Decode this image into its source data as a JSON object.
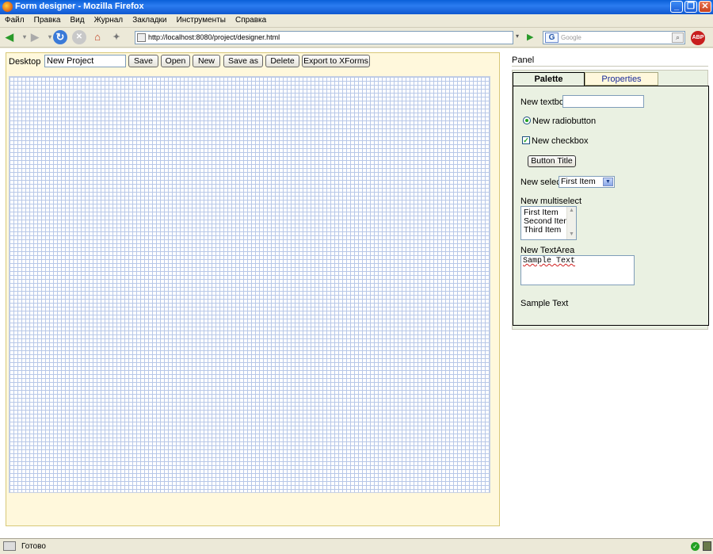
{
  "window": {
    "title": "Form designer - Mozilla Firefox",
    "minimize": "_",
    "maximize": "❐",
    "close": "✕"
  },
  "menu": [
    "Файл",
    "Правка",
    "Вид",
    "Журнал",
    "Закладки",
    "Инструменты",
    "Справка"
  ],
  "nav": {
    "url": "http://localhost:8080/project/designer.html",
    "search_placeholder": "Google",
    "search_engine": "G",
    "abp": "ABP"
  },
  "desktop": {
    "label": "Desktop",
    "project_name": "New Project",
    "buttons": {
      "save": "Save",
      "open": "Open",
      "new": "New",
      "save_as": "Save as",
      "delete": "Delete",
      "export": "Export to XForms"
    }
  },
  "panel": {
    "title": "Panel",
    "tabs": {
      "palette": "Palette",
      "properties": "Properties"
    },
    "palette": {
      "textbox_label": "New textbox",
      "radio_label": "New radiobutton",
      "checkbox_label": "New checkbox",
      "button_title": "Button Title",
      "select_label": "New select",
      "select_value": "First Item",
      "multiselect_label": "New multiselect",
      "multiselect_options": [
        "First Item",
        "Second Item",
        "Third Item"
      ],
      "textarea_label": "New TextArea",
      "textarea_value": "Sample Text",
      "static_text": "Sample Text"
    }
  },
  "status": {
    "text": "Готово"
  },
  "colors": {
    "titlebar": "#0a5fd8",
    "desktop_bg": "#fff8dc",
    "panel_bg": "#eaf1e2",
    "grid_line": "#b8c8e8",
    "properties_tab_text": "#1a2a9a"
  }
}
